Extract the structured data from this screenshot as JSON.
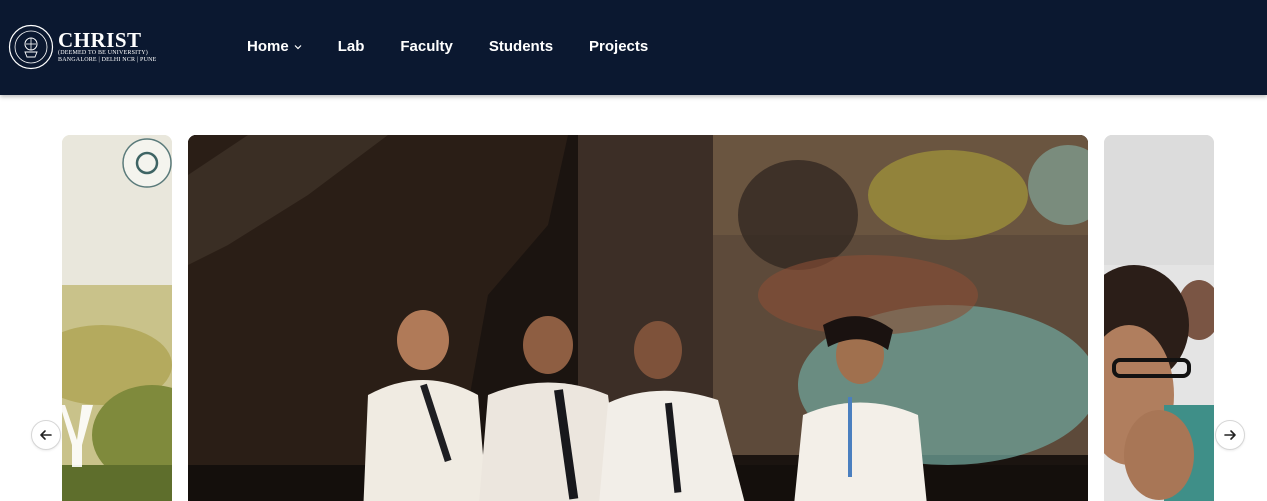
{
  "brand": {
    "name": "CHRIST",
    "subtitle": "(DEEMED TO BE UNIVERSITY)",
    "campuses": "BANGALORE | DELHI NCR | PUNE",
    "logo_icon": "university-seal-icon"
  },
  "nav": {
    "items": [
      {
        "label": "Home",
        "has_dropdown": true
      },
      {
        "label": "Lab",
        "has_dropdown": false
      },
      {
        "label": "Faculty",
        "has_dropdown": false
      },
      {
        "label": "Students",
        "has_dropdown": false
      },
      {
        "label": "Projects",
        "has_dropdown": false
      }
    ]
  },
  "carousel": {
    "prev_icon": "arrow-left-icon",
    "next_icon": "arrow-right-icon",
    "slides": [
      {
        "position": "previous",
        "content": "photo"
      },
      {
        "position": "current",
        "content": "photo"
      },
      {
        "position": "next",
        "content": "photo"
      }
    ]
  },
  "colors": {
    "navbar_bg": "#0b1830",
    "nav_text": "#ffffff"
  }
}
